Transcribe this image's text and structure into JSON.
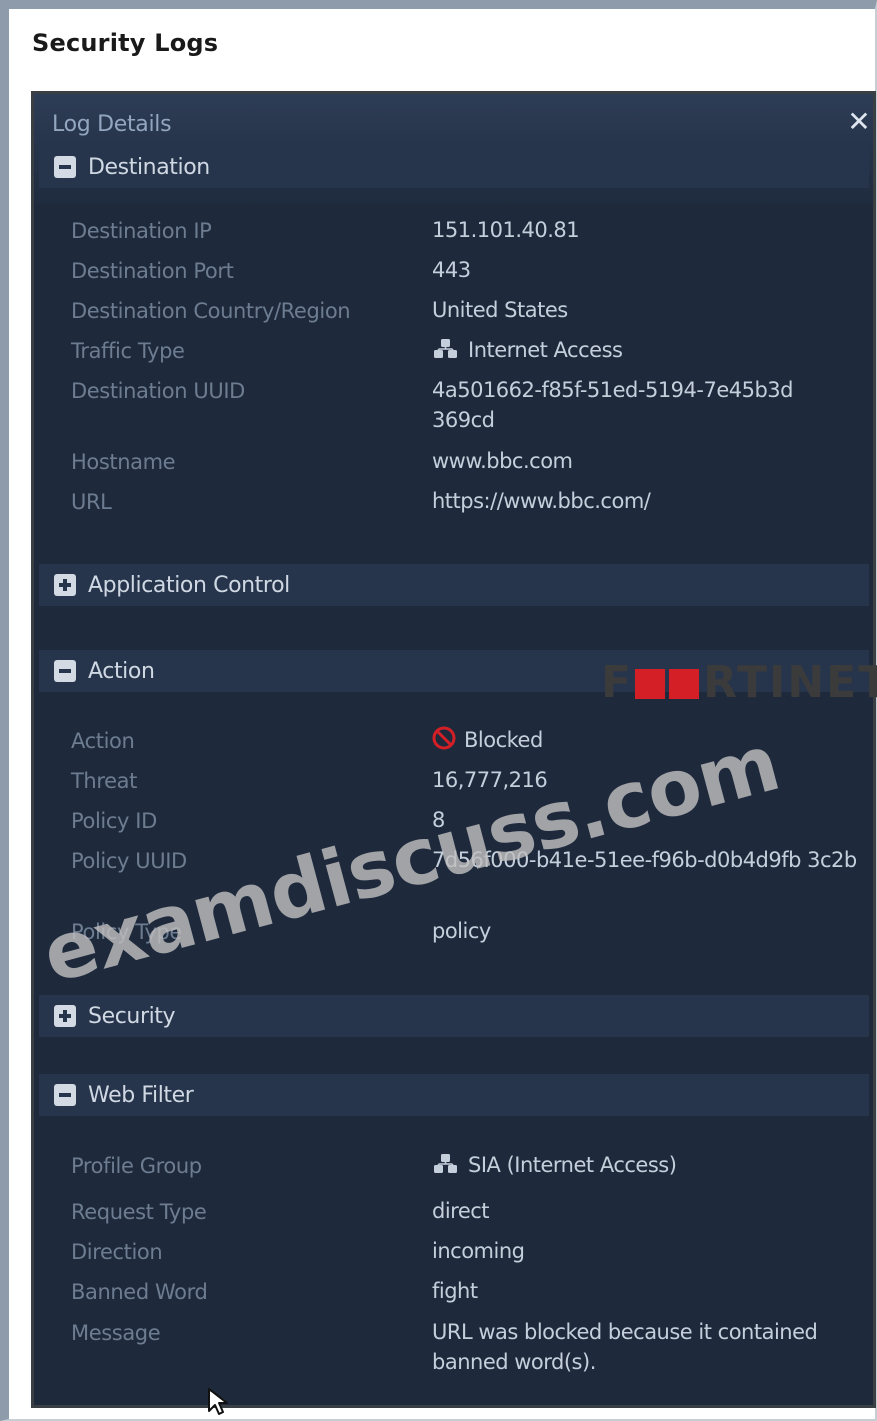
{
  "page": {
    "title": "Security Logs"
  },
  "panel": {
    "header": "Log Details",
    "close_icon": "close-icon"
  },
  "sections": {
    "destination": {
      "label": "Destination",
      "state": "expanded",
      "rows": [
        {
          "label": "Destination IP",
          "value": "151.101.40.81"
        },
        {
          "label": "Destination Port",
          "value": "443"
        },
        {
          "label": "Destination Country/Region",
          "value": "United States"
        },
        {
          "label": "Traffic Type",
          "value": "Internet Access",
          "icon": "network-icon"
        },
        {
          "label": "Destination UUID",
          "value": "4a501662-f85f-51ed-5194-7e45b3d 369cd"
        },
        {
          "label": "Hostname",
          "value": "www.bbc.com"
        },
        {
          "label": "URL",
          "value": "https://www.bbc.com/"
        }
      ]
    },
    "application_control": {
      "label": "Application Control",
      "state": "collapsed"
    },
    "action": {
      "label": "Action",
      "state": "expanded",
      "rows": [
        {
          "label": "Action",
          "value": "Blocked",
          "icon": "blocked-icon"
        },
        {
          "label": "Threat",
          "value": "16,777,216"
        },
        {
          "label": "Policy ID",
          "value": "8"
        },
        {
          "label": "Policy UUID",
          "value": "7d56f000-b41e-51ee-f96b-d0b4d9fb 3c2b"
        },
        {
          "label": "Policy Type",
          "value": "policy"
        }
      ]
    },
    "security": {
      "label": "Security",
      "state": "collapsed"
    },
    "web_filter": {
      "label": "Web Filter",
      "state": "expanded",
      "rows": [
        {
          "label": "Profile Group",
          "value": "SIA (Internet Access)",
          "icon": "network-icon"
        },
        {
          "label": "Request Type",
          "value": "direct"
        },
        {
          "label": "Direction",
          "value": "incoming"
        },
        {
          "label": "Banned Word",
          "value": "fight"
        },
        {
          "label": "Message",
          "value": "URL was blocked because it contained banned word(s)."
        }
      ]
    }
  },
  "overlay": {
    "watermark": "examdiscuss.com",
    "brand_start": "F",
    "brand_end": "RTINET"
  },
  "colors": {
    "panel_bg": "#1e2a3c",
    "section_bg": "#27354c",
    "label": "#6d7c91",
    "value": "#c5cfdb",
    "blocked_red": "#d51f26"
  }
}
